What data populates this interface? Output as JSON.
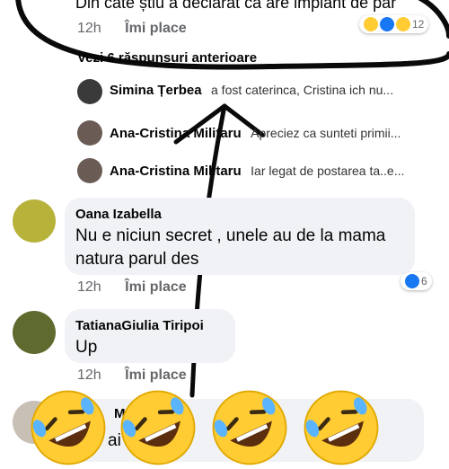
{
  "top_comment": {
    "text": "Din câte știu a declarat că are implant de păr",
    "time": "12h",
    "like_label": "Îmi place",
    "reaction_count": "12"
  },
  "previous_replies_link": "Vezi 6 răspunsuri anterioare",
  "replies": [
    {
      "name": "Simina Țerbea",
      "text": "a fost caterinca, Cristina ich nu..."
    },
    {
      "name": "Ana-Cristina Militaru",
      "text": "Apreciez ca sunteti primii..."
    },
    {
      "name": "Ana-Cristina Militaru",
      "text": "Iar legat de postarea ta..e..."
    }
  ],
  "comments": [
    {
      "name": "Oana Izabella",
      "line1": "Nu e niciun secret , unele au de la mama",
      "line2": "natura parul des",
      "time": "12h",
      "like_label": "Îmi place",
      "reaction_count": "6"
    },
    {
      "name": "TatianaGiulia Tiripoi",
      "line1": "Up",
      "time": "12h",
      "like_label": "Îmi place"
    }
  ],
  "partial_comment": {
    "name_fragment": "M",
    "text_fragment": "ai"
  },
  "colors": {
    "marker": "#0a0a0a",
    "bubble": "#f0f2f5",
    "like_blue": "#1877f2",
    "emoji_yellow": "#ffcc33"
  },
  "icons": [
    "like-icon",
    "heart-icon",
    "laughing-icon",
    "rofl-emoji"
  ]
}
